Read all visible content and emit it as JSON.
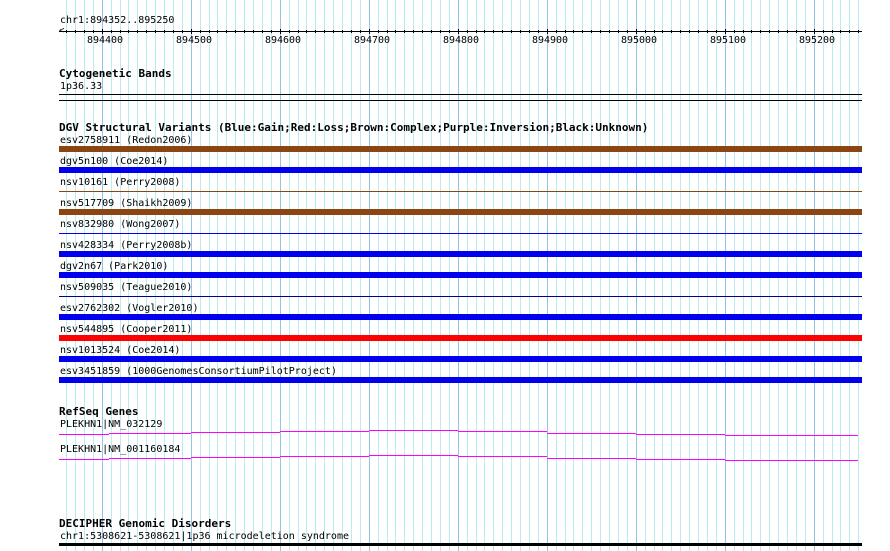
{
  "position": "chr1:894352..895250",
  "ruler": {
    "start": 894352,
    "end": 895250,
    "labels": [
      "894400",
      "894500",
      "894600",
      "894700",
      "894800",
      "894900",
      "895000",
      "895100",
      "895200"
    ]
  },
  "cytoband": {
    "title": "Cytogenetic Bands",
    "item": "1p36.33"
  },
  "dgv": {
    "title": "DGV Structural Variants (Blue:Gain;Red:Loss;Brown:Complex;Purple:Inversion;Black:Unknown)",
    "items": [
      {
        "label": "esv2758911 (Redon2006)",
        "color": "#8B4513",
        "thick": true
      },
      {
        "label": "dgv5n100 (Coe2014)",
        "color": "#0000EE",
        "thick": true
      },
      {
        "label": "nsv10161 (Perry2008)",
        "color": "#8B4513",
        "thick": false
      },
      {
        "label": "nsv517709 (Shaikh2009)",
        "color": "#8B4513",
        "thick": true
      },
      {
        "label": "nsv832980 (Wong2007)",
        "color": "#0000EE",
        "thick": false
      },
      {
        "label": "nsv428334 (Perry2008b)",
        "color": "#0000EE",
        "thick": true
      },
      {
        "label": "dgv2n67 (Park2010)",
        "color": "#0000EE",
        "thick": true
      },
      {
        "label": "nsv509035 (Teague2010)",
        "color": "#00008B",
        "thick": false
      },
      {
        "label": "esv2762302 (Vogler2010)",
        "color": "#0000EE",
        "thick": true
      },
      {
        "label": "nsv544895 (Cooper2011)",
        "color": "#FF0000",
        "thick": true
      },
      {
        "label": "nsv1013524 (Coe2014)",
        "color": "#0000EE",
        "thick": true
      },
      {
        "label": "esv3451859 (1000GenomesConsortiumPilotProject)",
        "color": "#0000EE",
        "thick": true
      }
    ]
  },
  "refseq": {
    "title": "RefSeq Genes",
    "items": [
      {
        "label": "PLEKHN1|NM_032129"
      },
      {
        "label": "PLEKHN1|NM_001160184"
      }
    ],
    "color": "#FF00FF"
  },
  "decipher": {
    "title": "DECIPHER Genomic Disorders",
    "item": "chr1:5308621-5308621|1p36 microdeletion syndrome"
  }
}
